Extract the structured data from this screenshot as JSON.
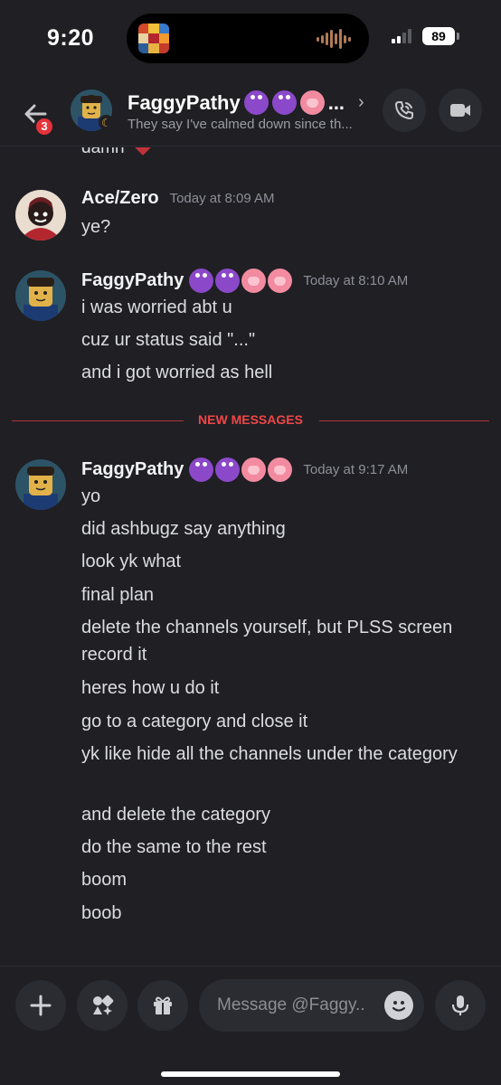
{
  "status_bar": {
    "time": "9:20",
    "battery": "89",
    "icons": [
      "album-art-icon",
      "audio-wave-icon",
      "signal-icon",
      "battery-icon"
    ]
  },
  "header": {
    "back_badge": "3",
    "name": "FaggyPathy",
    "name_suffix": "...",
    "status": "They say I've calmed down since th...",
    "icons": [
      "back-arrow-icon",
      "moon-idle-icon",
      "chevron-right-icon",
      "phone-call-icon",
      "video-camera-icon"
    ]
  },
  "messages": {
    "cutoff_text": "damn",
    "groups": [
      {
        "author": "Ace/Zero",
        "timestamp": "Today at 8:09 AM",
        "lines": [
          "ye?"
        ]
      },
      {
        "author": "FaggyPathy",
        "timestamp": "Today at 8:10 AM",
        "lines": [
          "i was worried abt u",
          "cuz ur status said \"...\"",
          "and i got worried as hell"
        ]
      },
      {
        "author": "FaggyPathy",
        "timestamp": "Today at 9:17 AM",
        "lines": [
          "yo",
          "did ashbugz say anything",
          "look yk what",
          "final plan",
          "delete the channels yourself, but PLSS screen record it",
          "heres how u do it",
          "go to a category and close it",
          "yk like hide all the channels under the category",
          "and delete the category",
          "do the same to the rest",
          "boom",
          "boob"
        ]
      }
    ],
    "divider_label": "NEW MESSAGES"
  },
  "composer": {
    "placeholder": "Message @Faggy..",
    "icons": [
      "plus-icon",
      "apps-icon",
      "gift-icon",
      "emoji-icon",
      "microphone-icon"
    ]
  },
  "colors": {
    "background": "#1f1f24",
    "surface": "#2b2c31",
    "new_messages_red": "#f04747",
    "badge_red": "#e5333a",
    "idle_yellow": "#f0b232"
  }
}
